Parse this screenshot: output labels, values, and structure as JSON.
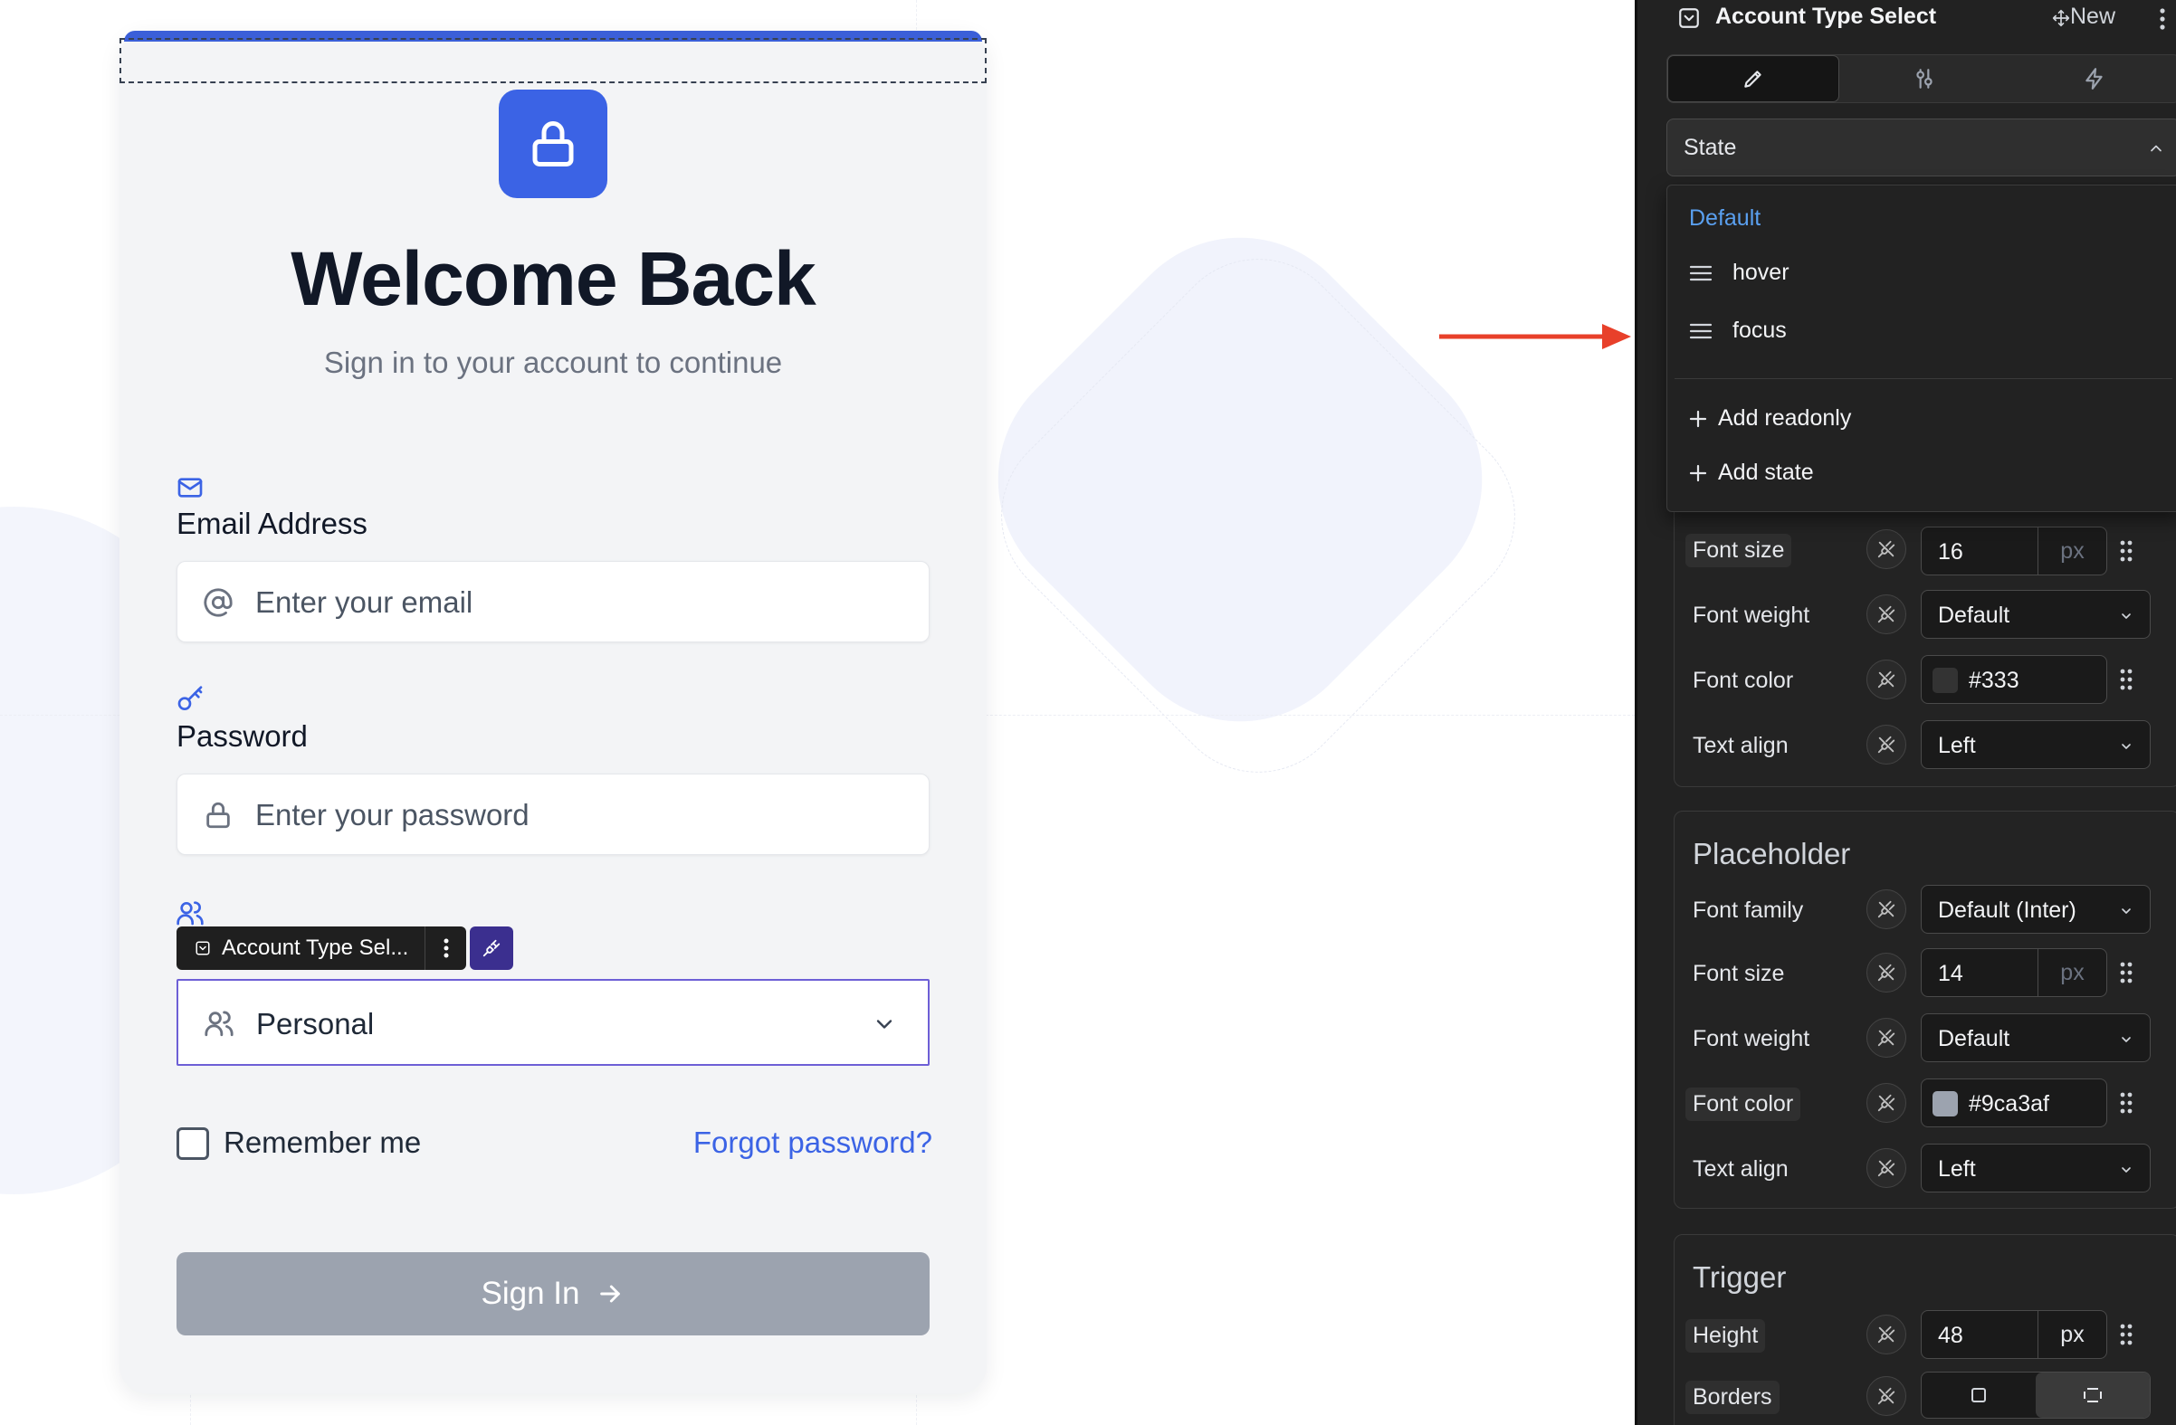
{
  "login": {
    "title": "Welcome Back",
    "subtitle": "Sign in to your account to continue",
    "email_label": "Email Address",
    "email_placeholder": "Enter your email",
    "password_label": "Password",
    "password_placeholder": "Enter your password",
    "account_type_value": "Personal",
    "selected_element_tag": "Account Type Sel...",
    "remember_label": "Remember me",
    "forgot_link": "Forgot password?",
    "signin_label": "Sign In"
  },
  "panel": {
    "title": "Account Type Select",
    "new_label": "New",
    "state_label": "State",
    "states": {
      "default": "Default",
      "items": [
        "hover",
        "focus"
      ],
      "add_readonly": "Add readonly",
      "add_state": "Add state"
    },
    "text_section": {
      "font_size_label": "Font size",
      "font_size_value": "16",
      "font_size_unit": "px",
      "font_weight_label": "Font weight",
      "font_weight_value": "Default",
      "font_color_label": "Font color",
      "font_color_value": "#333",
      "text_align_label": "Text align",
      "text_align_value": "Left"
    },
    "placeholder_section": {
      "title": "Placeholder",
      "font_family_label": "Font family",
      "font_family_value": "Default (Inter)",
      "font_size_label": "Font size",
      "font_size_value": "14",
      "font_size_unit": "px",
      "font_weight_label": "Font weight",
      "font_weight_value": "Default",
      "font_color_label": "Font color",
      "font_color_value": "#9ca3af",
      "text_align_label": "Text align",
      "text_align_value": "Left"
    },
    "trigger_section": {
      "title": "Trigger",
      "height_label": "Height",
      "height_value": "48",
      "height_unit": "px",
      "borders_label": "Borders"
    }
  },
  "colors": {
    "brand_blue": "#3b63e5",
    "select_outline": "#6d5fd6",
    "signin_disabled": "#9ca3af",
    "arrow_red": "#e8402a",
    "panel_bg": "#222222",
    "state_default": "#5aa0f0",
    "swatch_text": "#333333",
    "swatch_placeholder": "#9ca3af"
  },
  "icons": [
    "lock-icon",
    "mail-icon",
    "at-icon",
    "key-icon",
    "users-icon",
    "chevron-down-icon",
    "arrow-right-icon",
    "plug-icon",
    "more-vertical-icon",
    "pencil-icon",
    "sliders-icon",
    "bolt-icon",
    "grip-icon",
    "menu-icon",
    "plus-icon",
    "select-component-icon",
    "move-icon",
    "border-none-icon",
    "border-all-icon"
  ]
}
